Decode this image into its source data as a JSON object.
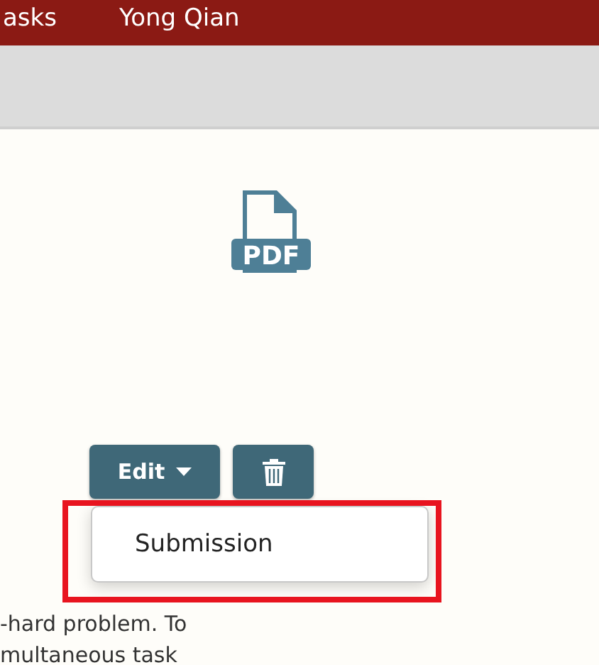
{
  "nav": {
    "items": [
      "asks",
      "Yong Qian"
    ]
  },
  "attachment": {
    "kind": "pdf",
    "label": "PDF"
  },
  "actions": {
    "edit_label": "Edit",
    "menu_open": true,
    "menu_items": [
      "Submission"
    ]
  },
  "annotation": {
    "kind": "frame",
    "color": "#e8141f"
  },
  "description": "-hard problem. To\nmultaneous task"
}
